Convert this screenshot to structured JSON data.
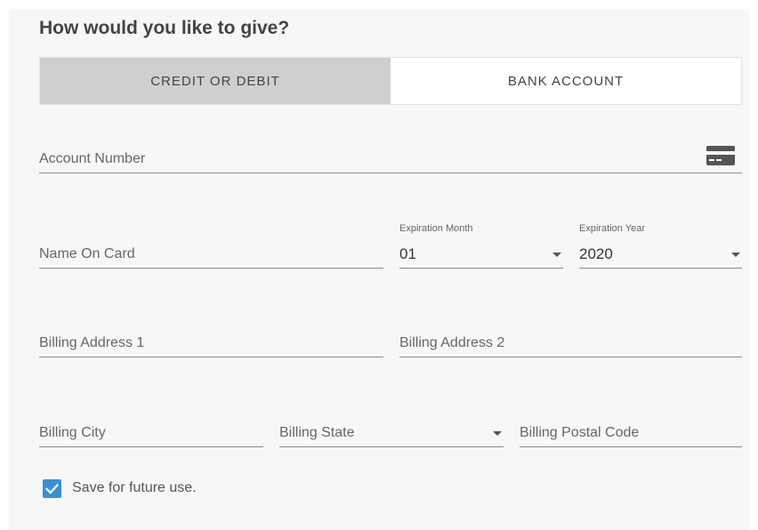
{
  "heading": "How would you like to give?",
  "tabs": [
    {
      "label": "CREDIT OR DEBIT",
      "active": true
    },
    {
      "label": "BANK ACCOUNT",
      "active": false
    }
  ],
  "fields": {
    "account_number": {
      "placeholder": "Account Number",
      "icon": "credit-card-icon"
    },
    "name_on_card": {
      "placeholder": "Name On Card"
    },
    "exp_month": {
      "label": "Expiration Month",
      "value": "01"
    },
    "exp_year": {
      "label": "Expiration Year",
      "value": "2020"
    },
    "billing_address_1": {
      "placeholder": "Billing Address 1"
    },
    "billing_address_2": {
      "placeholder": "Billing Address 2"
    },
    "billing_city": {
      "placeholder": "Billing City"
    },
    "billing_state": {
      "placeholder": "Billing State"
    },
    "billing_postal": {
      "placeholder": "Billing Postal Code"
    }
  },
  "save": {
    "label": "Save for future use.",
    "checked": true
  },
  "colors": {
    "accent": "#3b8fd4",
    "active_tab": "#cfcfcf",
    "panel": "#f7f7f7"
  }
}
